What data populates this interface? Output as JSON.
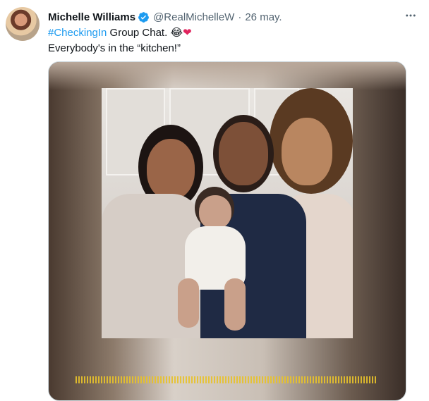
{
  "tweet": {
    "author_name": "Michelle Williams",
    "handle": "@RealMichelleW",
    "separator": "·",
    "date": "26 may.",
    "hashtag": "#CheckingIn",
    "text_after_hashtag": " Group Chat. ",
    "emoji_laugh": "😂",
    "emoji_heart": "❤",
    "line2": "Everybody's in the “kitchen!”"
  },
  "icons": {
    "verified": "verified-badge-icon",
    "more": "more-options-icon"
  },
  "colors": {
    "link": "#1d9bf0",
    "secondary_text": "#536471",
    "primary_text": "#0f1419",
    "heart": "#e0245e"
  }
}
